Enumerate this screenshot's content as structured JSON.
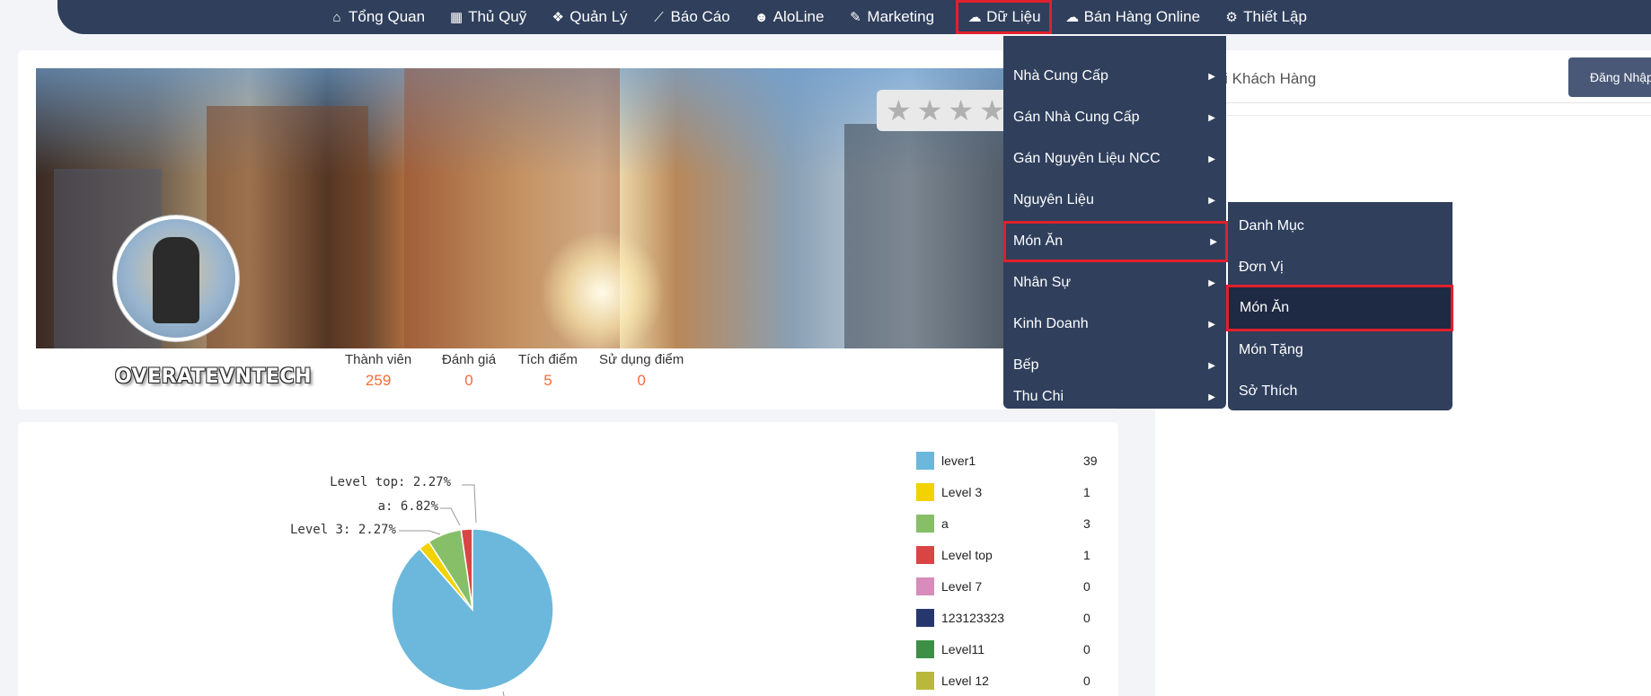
{
  "nav": {
    "items": [
      {
        "label": "Tổng Quan",
        "icon": "home-icon"
      },
      {
        "label": "Thủ Quỹ",
        "icon": "calculator-icon"
      },
      {
        "label": "Quản Lý",
        "icon": "cubes-icon"
      },
      {
        "label": "Báo Cáo",
        "icon": "line-chart-icon"
      },
      {
        "label": "AloLine",
        "icon": "users-icon"
      },
      {
        "label": "Marketing",
        "icon": "paintbrush-icon"
      },
      {
        "label": "Dữ Liệu",
        "icon": "cloud-upload-icon"
      },
      {
        "label": "Bán Hàng Online",
        "icon": "cloud-icon"
      },
      {
        "label": "Thiết Lập",
        "icon": "gear-icon"
      }
    ],
    "active": "Dữ Liệu"
  },
  "dropdown": {
    "items": [
      "Nhà Cung Cấp",
      "Gán Nhà Cung Cấp",
      "Gán Nguyên Liệu NCC",
      "Nguyên Liệu",
      "Món Ăn",
      "Nhân Sự",
      "Kinh Doanh",
      "Bếp",
      "Thu Chi"
    ],
    "selected": "Món Ăn"
  },
  "submenu": {
    "items": [
      "Danh Mục",
      "Đơn Vị",
      "Món Ăn",
      "Món Tặng",
      "Sở Thích"
    ],
    "selected": "Món Ăn"
  },
  "profile": {
    "name": "OVERATEVNTECH",
    "stats": [
      {
        "label": "Thành viên",
        "value": "259"
      },
      {
        "label": "Đánh giá",
        "value": "0"
      },
      {
        "label": "Tích điểm",
        "value": "5"
      },
      {
        "label": "Sử dụng điểm",
        "value": "0"
      }
    ]
  },
  "right_panel": {
    "title": "ời Khách Hàng",
    "login_button": "Đăng Nhập"
  },
  "chart_data": {
    "type": "pie",
    "title": "",
    "series": [
      {
        "name": "lever1",
        "value": 39,
        "color": "#6bb8dc"
      },
      {
        "name": "Level 3",
        "value": 1,
        "color": "#f2d200"
      },
      {
        "name": "a",
        "value": 3,
        "color": "#86bf68"
      },
      {
        "name": "Level top",
        "value": 1,
        "color": "#d94545"
      },
      {
        "name": "Level 7",
        "value": 0,
        "color": "#d88cbb"
      },
      {
        "name": "123123323",
        "value": 0,
        "color": "#27376e"
      },
      {
        "name": "Level11",
        "value": 0,
        "color": "#3d8f46"
      },
      {
        "name": "Level 12",
        "value": 0,
        "color": "#b8b83a"
      }
    ],
    "slice_labels": [
      "Level top: 2.27%",
      "a: 6.82%",
      "Level 3: 2.27%"
    ],
    "legend_position": "right"
  }
}
